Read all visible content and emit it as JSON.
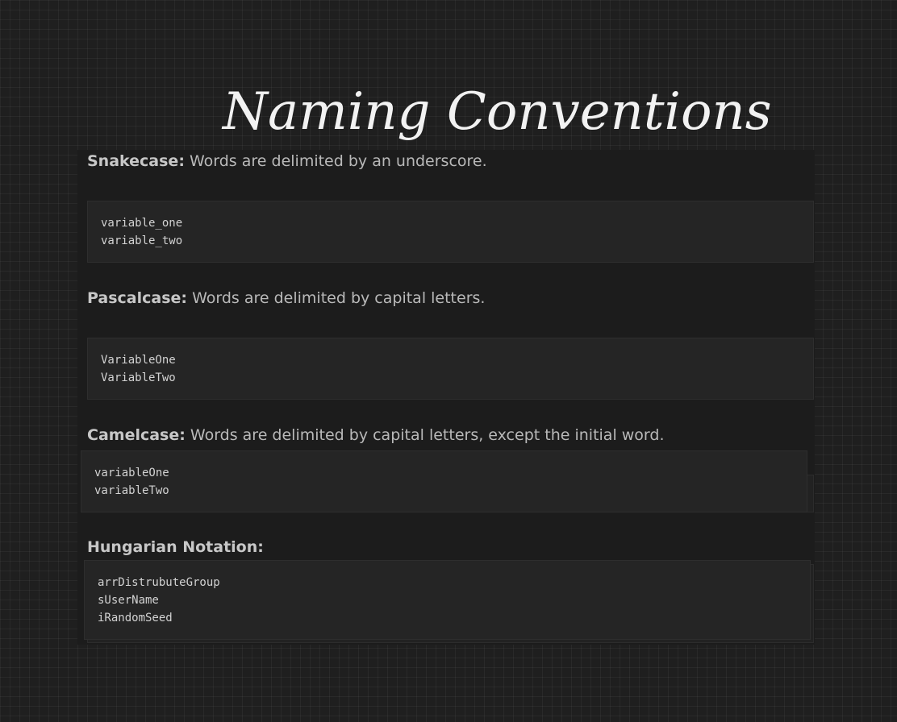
{
  "title": "Naming Conventions",
  "sections": [
    {
      "term": "Snakecase:",
      "description": "Words are delimited by an underscore.",
      "code": [
        "variable_one",
        "variable_two"
      ]
    },
    {
      "term": "Pascalcase:",
      "description": "Words are delimited by capital letters.",
      "code": [
        "VariableOne",
        "VariableTwo"
      ]
    },
    {
      "term": "Camelcase:",
      "description": "Words are delimited by capital letters, except the initial word.",
      "code": [
        "variableOne",
        "variableTwo"
      ]
    },
    {
      "term": "Hungarian Notation:",
      "description": "",
      "code": [
        "arrDistrubuteGroup",
        "sUserName",
        "iRandomSeed"
      ]
    }
  ]
}
